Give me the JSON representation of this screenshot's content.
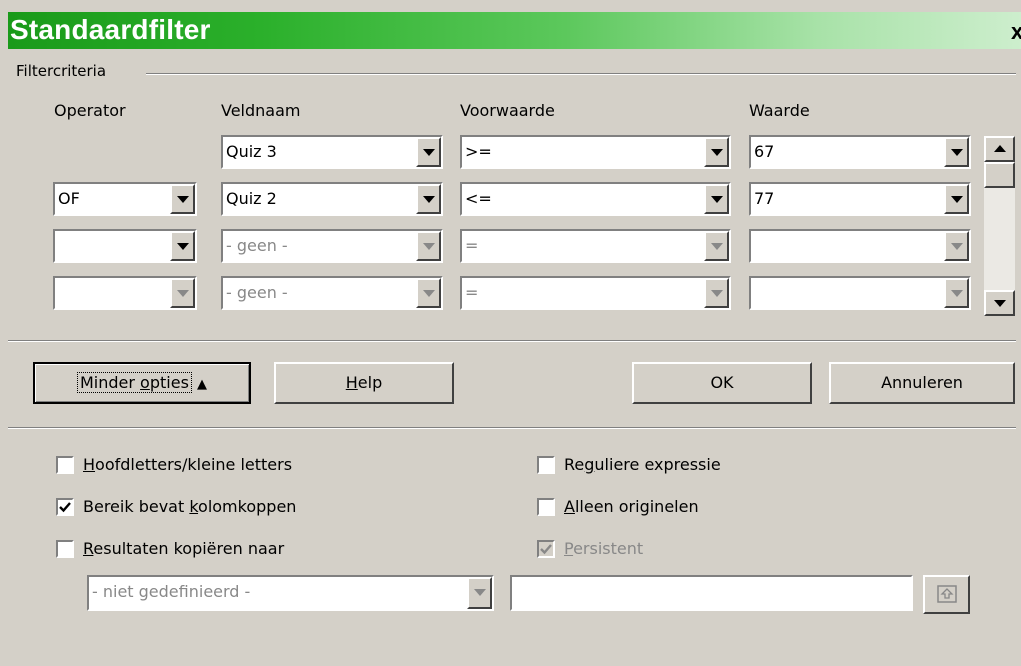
{
  "window": {
    "title": "Standaardfilter",
    "close_label": "x"
  },
  "criteria": {
    "group_label": "Filtercriteria",
    "headers": {
      "operator": "Operator",
      "field": "Veldnaam",
      "condition": "Voorwaarde",
      "value": "Waarde"
    },
    "rows": [
      {
        "operator": "",
        "field": "Quiz 3",
        "condition": ">=",
        "value": "67"
      },
      {
        "operator": "OF",
        "field": "Quiz 2",
        "condition": "<=",
        "value": "77"
      },
      {
        "operator": "",
        "field": "- geen -",
        "condition": "=",
        "value": ""
      },
      {
        "operator": "",
        "field": "- geen -",
        "condition": "=",
        "value": ""
      }
    ]
  },
  "buttons": {
    "less_options_pre": "Minder ",
    "less_options_ul": "o",
    "less_options_post": "pties",
    "less_options_arrow": "▲",
    "help_ul": "H",
    "help_post": "elp",
    "ok": "OK",
    "cancel": "Annuleren"
  },
  "options": {
    "case_sensitive": {
      "ul": "H",
      "rest": "oofdletters/kleine letters",
      "checked": false
    },
    "header_row": {
      "pre": "Bereik bevat ",
      "ul": "k",
      "rest": "olomkoppen",
      "checked": true
    },
    "copy_results": {
      "ul": "R",
      "rest": "esultaten kopiëren naar",
      "checked": false
    },
    "regex": {
      "pre": "Re",
      "ul": "g",
      "rest": "uliere expressie",
      "checked": false
    },
    "unique": {
      "ul": "A",
      "rest": "lleen originelen",
      "checked": false
    },
    "persistent": {
      "ul": "P",
      "rest": "ersistent",
      "checked": true,
      "disabled": true
    },
    "copy_target": "- niet gedefinieerd -",
    "copy_target_text": ""
  }
}
